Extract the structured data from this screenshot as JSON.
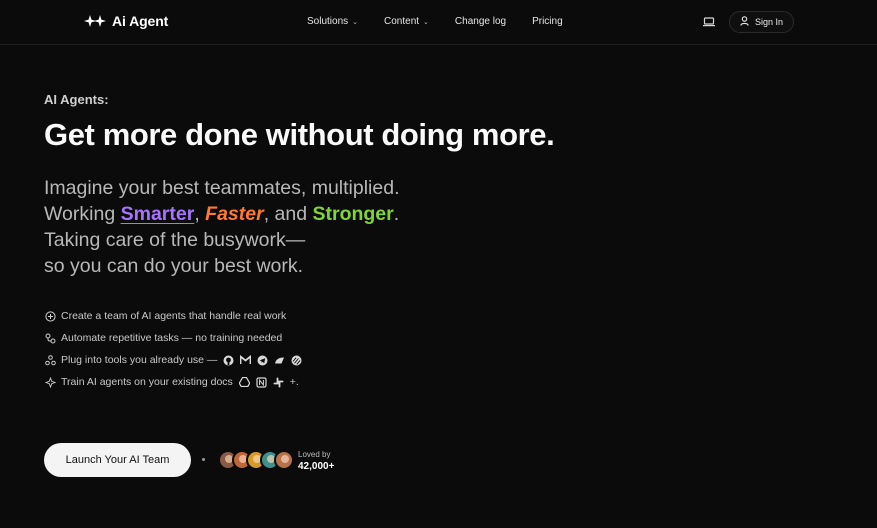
{
  "nav": {
    "logo_text": "Ai Agent",
    "menu": [
      {
        "label": "Solutions",
        "has_dropdown": true
      },
      {
        "label": "Content",
        "has_dropdown": true
      },
      {
        "label": "Change log",
        "has_dropdown": false
      },
      {
        "label": "Pricing",
        "has_dropdown": false
      }
    ],
    "signin_label": "Sign In"
  },
  "hero": {
    "eyebrow": "AI Agents:",
    "headline": "Get more done without doing more.",
    "sub_line1": "Imagine your best teammates, multiplied.",
    "sub_line2_prefix": "Working ",
    "smarter": "Smarter",
    "comma1": ", ",
    "faster": "Faster",
    "and_text": ", and ",
    "stronger": "Stronger",
    "period": ".",
    "sub_line3": "Taking care of the busywork—",
    "sub_line4": "so you can do your best work.",
    "colors": {
      "smarter": "#a874ff",
      "faster": "#ff7a2f",
      "stronger": "#7fd43a"
    }
  },
  "features": [
    {
      "icon": "plus-circle-icon",
      "text": "Create a team of AI agents that handle real work"
    },
    {
      "icon": "workflow-icon",
      "text": "Automate repetitive tasks — no training needed"
    },
    {
      "icon": "integrations-icon",
      "text": "Plug into tools you already use —",
      "tools": [
        "github-icon",
        "gmail-icon",
        "telegram-icon",
        "zapier-icon",
        "linear-icon"
      ]
    },
    {
      "icon": "sparkle-icon",
      "text": "Train AI agents on your existing docs",
      "tools": [
        "google-drive-icon",
        "notion-icon",
        "slack-icon"
      ],
      "suffix": "+."
    }
  ],
  "cta": {
    "label": "Launch Your AI Team"
  },
  "social_proof": {
    "label": "Loved by",
    "count": "42,000+",
    "avatar_colors": [
      "#8a5a44",
      "#c0673a",
      "#d49a2a",
      "#3f8f8a",
      "#b5714b"
    ]
  }
}
